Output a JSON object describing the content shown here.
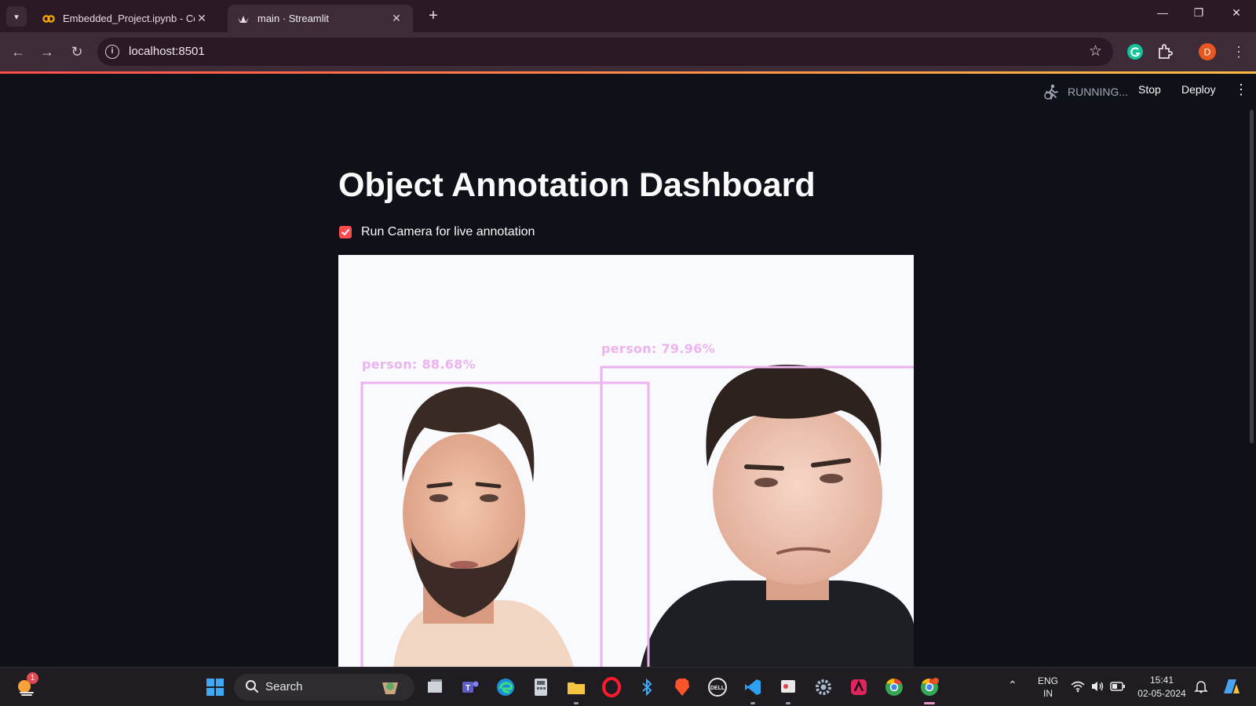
{
  "browser": {
    "tabs": [
      {
        "title": "Embedded_Project.ipynb - Cola",
        "active": false,
        "icon": "colab-icon"
      },
      {
        "title": "main · Streamlit",
        "active": true,
        "icon": "streamlit-icon"
      }
    ],
    "url": "localhost:8501",
    "profile_initial": "D"
  },
  "app": {
    "status": "RUNNING...",
    "stop_label": "Stop",
    "deploy_label": "Deploy",
    "title": "Object Annotation Dashboard",
    "checkbox_label": "Run Camera for live annotation",
    "checkbox_checked": true,
    "accent": "#ff4b4b",
    "detections": [
      {
        "label": "person:  88.68%"
      },
      {
        "label": "person:  79.96%"
      }
    ]
  },
  "taskbar": {
    "search_placeholder": "Search",
    "weather_badge": "1",
    "language": "ENG",
    "region": "IN",
    "time": "15:41",
    "date": "02-05-2024"
  }
}
